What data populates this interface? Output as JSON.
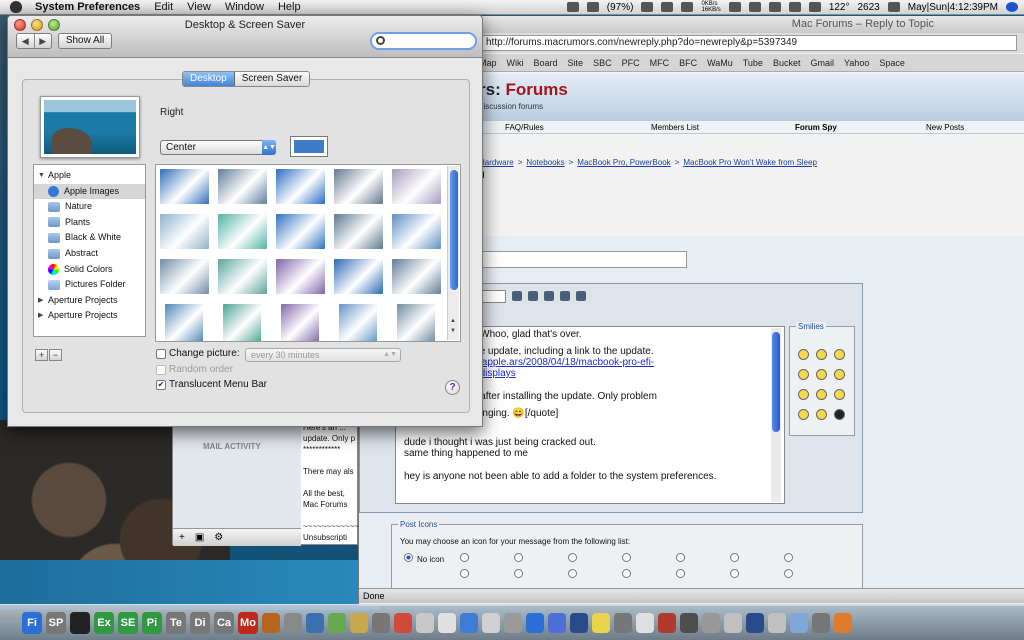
{
  "menubar": {
    "app_name": "System Preferences",
    "menus": [
      "Edit",
      "View",
      "Window",
      "Help"
    ],
    "battery": "(97%)",
    "net_up": "0KB/s",
    "net_down": "16KB/s",
    "temperature": "122°",
    "fan": "2623",
    "clock": "May|Sun|4:12:39PM"
  },
  "browser": {
    "title": "Mac Forums – Reply to Topic",
    "url": "http://forums.macrumors.com/newreply.php?do=newreply&p=5397349",
    "bookmarks": [
      "Map",
      "Wiki",
      "Board",
      "Site",
      "SBC",
      "PFC",
      "MFC",
      "BFC",
      "WaMu",
      "Tube",
      "Bucket",
      "Gmail",
      "Yahoo",
      "Space"
    ],
    "logo_prefix": "rs: ",
    "logo_accent": "Forums",
    "tagline": "discussion forums",
    "menu": {
      "faq": "FAQ/Rules",
      "members": "Members List",
      "spy": "Forum Spy",
      "new_posts": "New Posts"
    },
    "breadcrumb": [
      "Hardware",
      "Notebooks",
      "MacBook Pro, PowerBook",
      "MacBook Pro Won't Wake from Sleep"
    ],
    "breadcrumb_seps": [
      ">",
      ">",
      ">"
    ],
    "page_d": "d",
    "size_value": "2",
    "message_lines": [
      "ew sleep issues. Whoo, glad that's over.",
      "sting article on the update, including a link to the update.",
      "tica.com/journals/apple.ars/2008/04/18/macbook-pro-efi-",
      "ly-causing-blank-displays",
      "k have problems after installing the update. Only problem",
      "shop defaults changing. 😄[/quote]",
      "dude i thought i was just being cracked out.",
      "same thing happened to me",
      "hey is anyone not been able to add a folder to the system preferences."
    ],
    "smilies_label": "Smilies",
    "post_icons_label": "Post Icons",
    "post_icons_intro": "You may choose an icon for your message from the following list:",
    "no_icon_label": "No icon",
    "status": "Done"
  },
  "mail": {
    "activity_label": "MAIL ACTIVITY",
    "text_lines": [
      "Here's an ... update. Only p",
      "************",
      "",
      "There may als",
      "",
      "All the best,",
      "Mac Forums",
      "",
      "~~~~~~~~~~~~",
      "Unsubscripti"
    ]
  },
  "prefs": {
    "title": "Desktop & Screen Saver",
    "show_all": "Show All",
    "search_value": "",
    "tabs": [
      "Desktop",
      "Screen Saver"
    ],
    "selected_tab": "Desktop",
    "picture_name": "Right",
    "position_value": "Center",
    "accent_color": "#3d7cc9",
    "source_list": [
      {
        "label": "Apple",
        "type": "group",
        "expanded": true
      },
      {
        "label": "Apple Images",
        "type": "apple",
        "selected": true
      },
      {
        "label": "Nature",
        "type": "folder"
      },
      {
        "label": "Plants",
        "type": "folder"
      },
      {
        "label": "Black & White",
        "type": "folder"
      },
      {
        "label": "Abstract",
        "type": "folder"
      },
      {
        "label": "Solid Colors",
        "type": "color"
      },
      {
        "label": "Pictures Folder",
        "type": "pictures"
      },
      {
        "label": "Aperture Projects",
        "type": "group",
        "expanded": false
      },
      {
        "label": "Aperture Projects",
        "type": "group",
        "expanded": false
      }
    ],
    "thumb_colors": [
      "#2f6fb8",
      "#5f7d9c",
      "#2a6cc4",
      "#64788e",
      "#a79bc0",
      "#8fb1cc",
      "#4fb4a2",
      "#2d72c2",
      "#5d7890",
      "#5d8fc3",
      "#6f8ca6",
      "#5ba39c",
      "#7e64a8",
      "#2a67b6",
      "#607c98",
      "#4e86b8",
      "#4ba595",
      "#8266a8",
      "#6295c4",
      "#6e8a9f"
    ],
    "change_picture_label": "Change picture:",
    "change_picture_checked": false,
    "interval_value": "every 30 minutes",
    "random_order_label": "Random order",
    "random_order_checked": false,
    "translucent_label": "Translucent Menu Bar",
    "translucent_checked": true
  },
  "dock": {
    "labeled_items": [
      "Fi",
      "SP",
      "",
      "Ex",
      "SE",
      "Pi",
      "Te",
      "Di",
      "Ca",
      "Mo"
    ],
    "labeled_colors": [
      "#2a6fd6",
      "#777777",
      "#222222",
      "#2f9a42",
      "#2f9a42",
      "#2f9a42",
      "#777777",
      "#777777",
      "#777777",
      "#c0271d"
    ],
    "icon_colors": [
      "#b5651d",
      "#888888",
      "#3a6fb0",
      "#6aa84f",
      "#c7a84c",
      "#777777",
      "#d04a3a",
      "#c7c7c7",
      "#e0e0e0",
      "#3b7dd8",
      "#d0d0d0",
      "#9a9a9a",
      "#2a6fd6",
      "#4d6fd8",
      "#2a4a8c",
      "#e8d34a",
      "#777777",
      "#e0e0e0",
      "#b23a2a",
      "#4d4d4d",
      "#999999",
      "#c0c0c0",
      "#2a4a8c",
      "#c0c0c0",
      "#7fa8d8",
      "#777777",
      "#e07a2a"
    ]
  }
}
